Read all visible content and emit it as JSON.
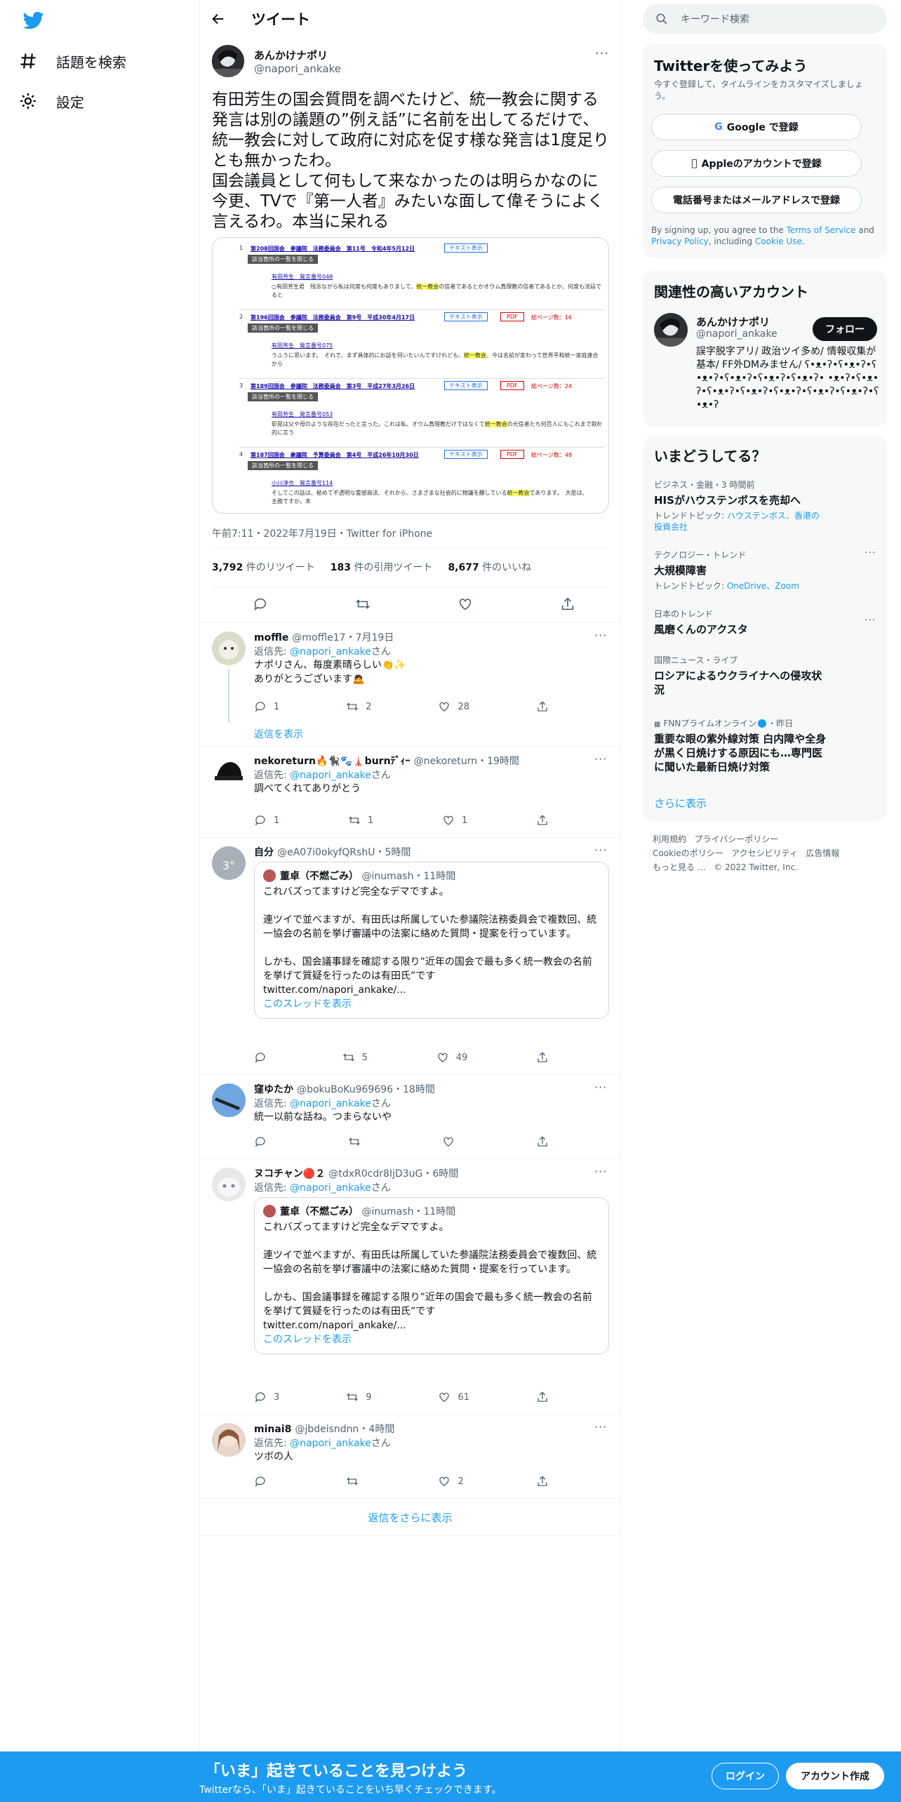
{
  "nav": {
    "explore": "話題を検索",
    "settings": "設定"
  },
  "header": {
    "title": "ツイート"
  },
  "main_tweet": {
    "name": "あんかけナポリ",
    "handle": "@napori_ankake",
    "text": "有田芳生の国会質問を調べたけど、統一教会に関する発言は別の議題の”例え話”に名前を出してるだけで、統一教会に対して政府に対応を促す様な発言は1度足りとも無かったわ。\n国会議員として何もして来なかったのは明らかなのに今更、TVで『第一人者』みたいな面して偉そうによく言えるわ。本当に呆れる",
    "meta": "午前7:11・2022年7月19日・Twitter for iPhone",
    "retweets_count": "3,792",
    "retweets_label": "件のリツイート",
    "quotes_count": "183",
    "quotes_label": "件の引用ツイート",
    "likes_count": "8,677",
    "likes_label": "件のいいね"
  },
  "media": {
    "rows": [
      {
        "num": "1",
        "title": "第208回国会　参議院　法務委員会　第11号　令和4年5月12日",
        "btn": "テキスト表示",
        "toggle": "該当箇所の一覧を閉じる",
        "speaker": "有田芳生　発言番号048",
        "line": "○有田芳生君　残念ながら私は何度も何度もありまして、統一教会の信者であるとかオウム真理教の信者であるとか、何度も法廷で",
        "tail": "ると"
      },
      {
        "num": "2",
        "title": "第196回国会　参議院　法務委員会　第9号　平成30年4月17日",
        "btn": "テキスト表示",
        "pdf": "PDF",
        "pages": "総ページ数：16",
        "toggle": "該当箇所の一覧を閉じる",
        "speaker": "有田芳生　発言番号075",
        "line": "うふうに思います。　それで、まず具体的にお話を伺いたいんですけれども、統一教会、今は名前が変わって世界平和統一家庭連合",
        "tail": "から"
      },
      {
        "num": "3",
        "title": "第189回国会　参議院　法務委員会　第3号　平成27年3月26日",
        "btn": "テキスト表示",
        "pdf": "PDF",
        "pages": "総ページ数：24",
        "toggle": "該当箇所の一覧を閉じる",
        "speaker": "有田芳生　発言番号053",
        "line": "彰晃は父や母のような存在だったと言った。これは私、オウム真理教だけではなくて統一教会の元信者たち何百人にもこれまで取材",
        "tail": "的に言う"
      },
      {
        "num": "4",
        "title": "第187回国会　衆議院　予算委員会　第4号　平成26年10月30日",
        "btn": "テキスト表示",
        "pdf": "PDF",
        "pages": "総ページ数：48",
        "toggle": "該当箇所の一覧を閉じる",
        "speaker": "小川淳也　発言番号114",
        "line": "そしてこの話は、極めて不透明な霊感商法、それから、さまざまな社会的に物議を醸している統一教会であります。　大臣は、",
        "tail": "主務ですか。末"
      }
    ]
  },
  "replies": [
    {
      "name": "moffle",
      "handle": "@moffle17",
      "time": "・7月19日",
      "reply_prefix": "返信先: ",
      "reply_to": "@napori_ankake",
      "reply_suffix": "さん",
      "text": "ナポリさん、毎度素晴らしい👏✨\nありがとうございます🙇",
      "replies": "1",
      "retweets": "2",
      "likes": "28",
      "show_thread": "返信を表示"
    },
    {
      "name": "nekoreturn🔥🐈‍⬛🐾🗼burnﾃﾞｨｰ",
      "handle": "@nekoreturn",
      "time": "・19時間",
      "reply_prefix": "返信先: ",
      "reply_to": "@napori_ankake",
      "reply_suffix": "さん",
      "text": "調べてくれてありがとう",
      "replies": "1",
      "retweets": "1",
      "likes": "1"
    },
    {
      "name": "自分",
      "handle": "@eA07i0okyfQRshU",
      "time": "・5時間",
      "avatar_badge": "3°",
      "quote": {
        "name": "董卓（不燃ごみ）",
        "handle": "@inumash",
        "time": "・11時間",
        "p1": "これバズってますけど完全なデマですよ。",
        "p2": "連ツイで並べますが、有田氏は所属していた参議院法務委員会で複数回、統一協会の名前を挙げ審議中の法案に絡めた質問・提案を行っています。",
        "p3": "しかも、国会議事録を確認する限り”近年の国会で最も多く統一教会の名前を挙げて質疑を行ったのは有田氏”です\ntwitter.com/napori_ankake/...",
        "thread": "このスレッドを表示"
      },
      "replies": "",
      "retweets": "5",
      "likes": "49"
    },
    {
      "name": "窪ゆたか",
      "handle": "@bokuBoKu969696",
      "time": "・18時間",
      "reply_prefix": "返信先: ",
      "reply_to": "@napori_ankake",
      "reply_suffix": "さん",
      "text": "統一以前な話ね。つまらないや",
      "replies": "",
      "retweets": "",
      "likes": ""
    },
    {
      "name": "ヌコチャン🔴２",
      "handle": "@tdxR0cdr8IjD3uG",
      "time": "・6時間",
      "reply_prefix": "返信先: ",
      "reply_to": "@napori_ankake",
      "reply_suffix": "さん",
      "quote": {
        "name": "董卓（不燃ごみ）",
        "handle": "@inumash",
        "time": "・11時間",
        "p1": "これバズってますけど完全なデマですよ。",
        "p2": "連ツイで並べますが、有田氏は所属していた参議院法務委員会で複数回、統一協会の名前を挙げ審議中の法案に絡めた質問・提案を行っています。",
        "p3": "しかも、国会議事録を確認する限り”近年の国会で最も多く統一教会の名前を挙げて質疑を行ったのは有田氏”です\ntwitter.com/napori_ankake/...",
        "thread": "このスレッドを表示"
      },
      "replies": "3",
      "retweets": "9",
      "likes": "61"
    },
    {
      "name": "minai8",
      "handle": "@jbdeisndnn",
      "time": "・4時間",
      "reply_prefix": "返信先: ",
      "reply_to": "@napori_ankake",
      "reply_suffix": "さん",
      "text": "ツボの人",
      "replies": "",
      "retweets": "",
      "likes": "2"
    }
  ],
  "show_more_replies": "返信をさらに表示",
  "sidebar": {
    "search_placeholder": "キーワード検索",
    "signup": {
      "title": "Twitterを使ってみよう",
      "subtitle": "今すぐ登録して、タイムラインをカスタマイズしましょう。",
      "google": "Google で登録",
      "apple": "Appleのアカウントで登録",
      "phone": "電話番号またはメールアドレスで登録",
      "terms_pre": "By signing up, you agree to the ",
      "terms_link": "Terms of Service",
      "terms_mid": " and ",
      "privacy_link": "Privacy Policy",
      "terms_mid2": ", including ",
      "cookie_link": "Cookie Use",
      "terms_end": "."
    },
    "related": {
      "title": "関連性の高いアカウント",
      "name": "あんかけナポリ",
      "handle": "@napori_ankake",
      "follow": "フォロー",
      "bio": "誤字脱字アリ/ 政治ツイ多め/ 情報収集が基本/ FF外DMみません/ ʕ•ᴥ•ʔ•ʕ•ᴥ•ʔ•ʕ•ᴥ•ʔ•ʕ•ᴥ•ʔ•ʕ•ᴥ•ʔ•ʕ•ᴥ•ʔ• •ᴥ•ʔ•ʕ•ᴥ•ʔ•ʕ•ᴥ•ʔ•ʕ•ᴥ•ʔ•ʕ•ᴥ•ʔ•ʕ•ᴥ•ʔ•ʕ•ᴥ•ʔ•ʕ•ᴥ•ʔ"
    },
    "trends": {
      "title": "いまどうしてる？",
      "items": [
        {
          "cat": "ビジネス・金融・3 時間前",
          "name": "HISがハウステンボスを売却へ",
          "sub_prefix": "トレンドトピック: ",
          "sub_links": "ハウステンボス、香港の投資会社"
        },
        {
          "cat": "テクノロジー・トレンド",
          "name": "大規模障害",
          "sub_prefix": "トレンドトピック: ",
          "sub_links": "OneDrive、Zoom"
        },
        {
          "cat": "日本のトレンド",
          "name": "風磨くんのアクスタ"
        },
        {
          "cat": "国際ニュース・ライブ",
          "name": "ロシアによるウクライナへの侵攻状況"
        },
        {
          "cat": "FNNプライムオンライン",
          "cat_time": "・昨日",
          "name": "重要な眼の紫外線対策 白内障や全身が黒く日焼けする原因にも…専門医に聞いた最新日焼け対策"
        }
      ],
      "show_more": "さらに表示"
    },
    "footer": {
      "terms": "利用規約",
      "privacy": "プライバシーポリシー",
      "cookie": "Cookieのポリシー",
      "access": "アクセシビリティ",
      "ads": "広告情報",
      "more": "もっと見る …",
      "copyright": "© 2022 Twitter, Inc."
    }
  },
  "banner": {
    "title": "「いま」起きていることを見つけよう",
    "subtitle": "Twitterなら、「いま」起きていることをいち早くチェックできます。",
    "login": "ログイン",
    "signup": "アカウント作成"
  },
  "colors": {
    "accent": "#1d9bf0",
    "text": "#0f1419",
    "muted": "#536471",
    "border": "#eff3f4",
    "highlight": "#ffff66"
  }
}
